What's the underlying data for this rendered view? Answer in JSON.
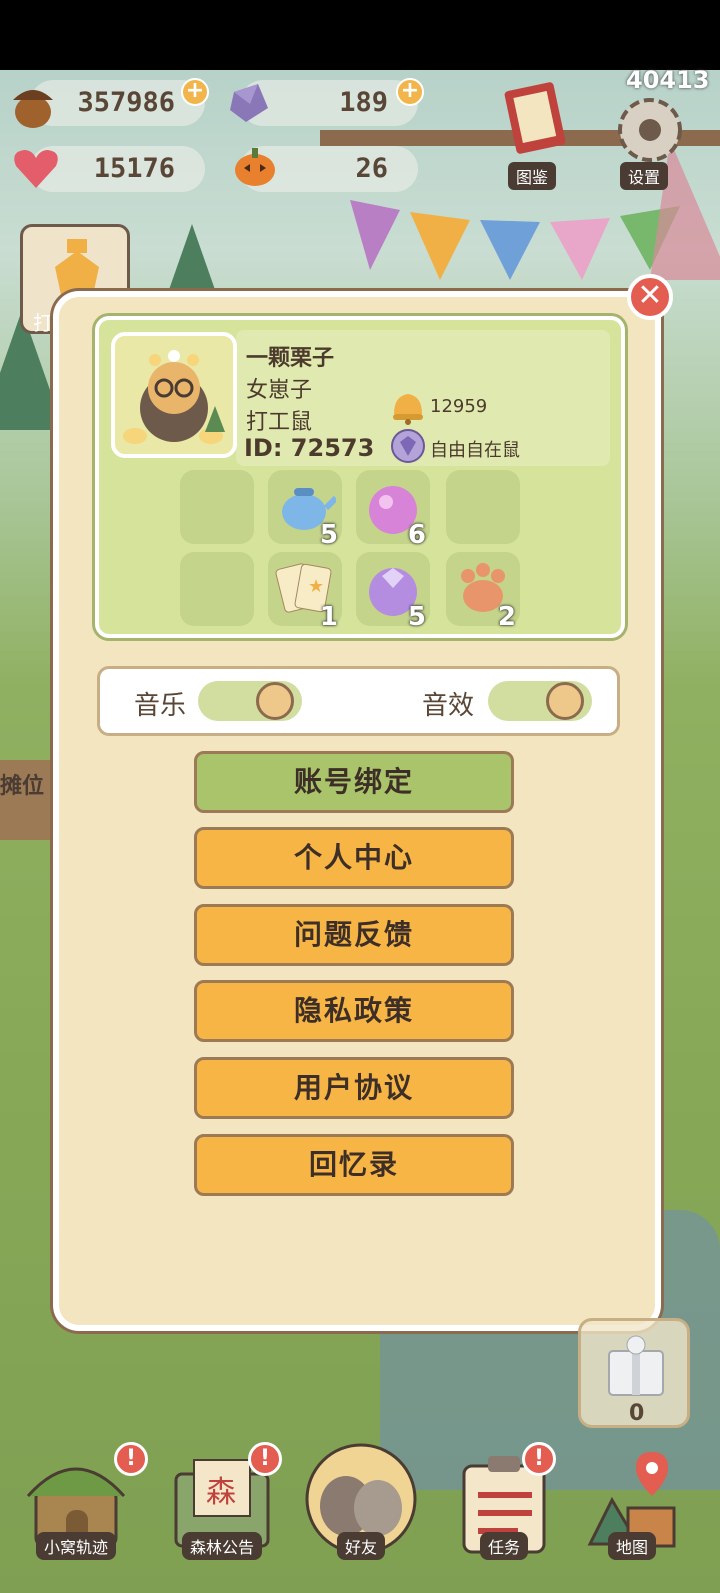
{
  "hud": {
    "acorn": "357986",
    "crystal": "189",
    "hearts": "15176",
    "pumpkin": "26",
    "top_right": "40413"
  },
  "top_buttons": {
    "collection": "图鉴",
    "settings": "设置"
  },
  "left_partial": {
    "work": "打",
    "stall": "摊位"
  },
  "profile": {
    "name": "一颗栗子",
    "gender": "女崽子",
    "title": "打工鼠",
    "id": "ID: 72573",
    "bells": "12959",
    "badge": "自由自在鼠"
  },
  "items": [
    {
      "name": "teapot",
      "count": "5"
    },
    {
      "name": "pink-orb",
      "count": "6"
    },
    {
      "name": "cards",
      "count": "1"
    },
    {
      "name": "purple-gem",
      "count": "5"
    },
    {
      "name": "paw",
      "count": "2"
    }
  ],
  "toggles": {
    "music": "音乐",
    "sfx": "音效"
  },
  "menu": [
    "账号绑定",
    "个人中心",
    "问题反馈",
    "隐私政策",
    "用户协议",
    "回忆录"
  ],
  "gift_count": "0",
  "nav": {
    "nest": "小窝轨迹",
    "forest": "森林公告",
    "friends": "好友",
    "tasks": "任务",
    "map": "地图"
  },
  "colors": {
    "menu_orange": "#f7b545",
    "menu_green": "#a9c46a",
    "close_red": "#e35d50",
    "panel": "#f2e5bf"
  }
}
